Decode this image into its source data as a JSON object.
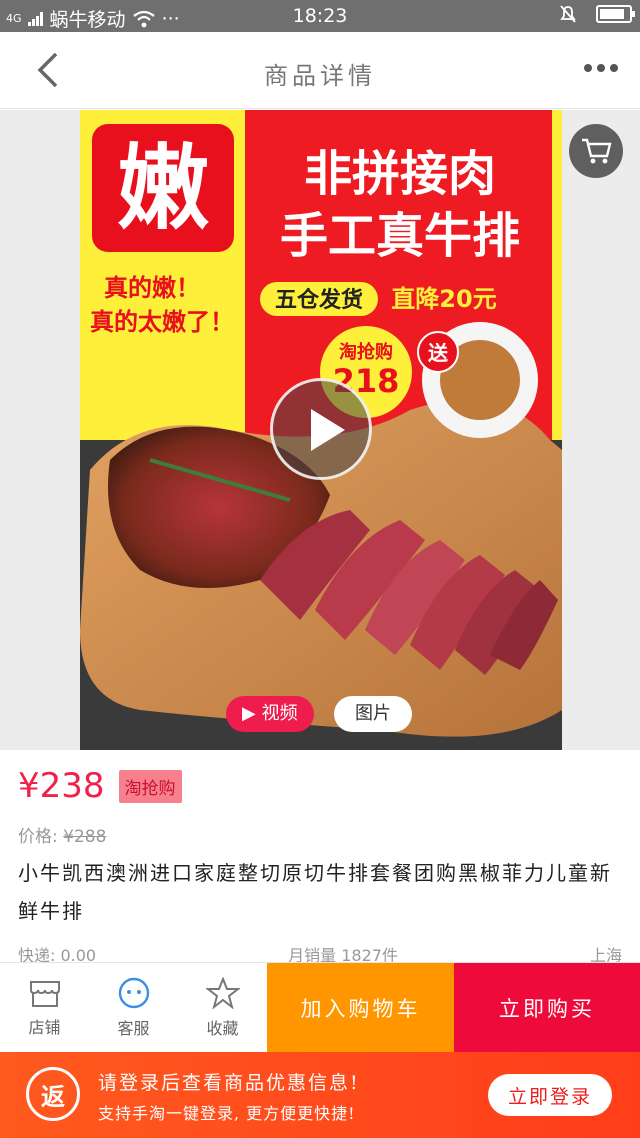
{
  "status": {
    "network": "4G",
    "carrier": "蜗牛移动",
    "extra": "···",
    "time": "18:23"
  },
  "nav": {
    "title": "商品详情"
  },
  "banner": {
    "badge": "嫩",
    "headline1": "非拼接肉",
    "headline2": "手工真牛排",
    "slogan1": "真的嫩！",
    "slogan2": "真的太嫩了！",
    "ship": "五仓发货",
    "discount": "直降20元",
    "promo_label": "淘抢购",
    "promo_price": "218",
    "gift": "送"
  },
  "media_tabs": {
    "video": "视频",
    "photo": "图片"
  },
  "product": {
    "price": "¥238",
    "price_tag": "淘抢购",
    "orig_label": "价格:",
    "orig_price": "¥288",
    "title": "小牛凯西澳洲进口家庭整切原切牛排套餐团购黑椒菲力儿童新鲜牛排",
    "shipping": "快递: 0.00",
    "sales": "月销量 1827件",
    "location": "上海"
  },
  "actions": {
    "shop": "店铺",
    "service": "客服",
    "favorite": "收藏",
    "add_cart": "加入购物车",
    "buy_now": "立即购买"
  },
  "login": {
    "icon_text": "返",
    "line1": "请登录后查看商品优惠信息!",
    "line2": "支持手淘一键登录, 更方便更快捷!",
    "button": "立即登录"
  },
  "colors": {
    "accent": "#ee0a3a",
    "orange": "#ff9600",
    "price": "#f0214a"
  }
}
